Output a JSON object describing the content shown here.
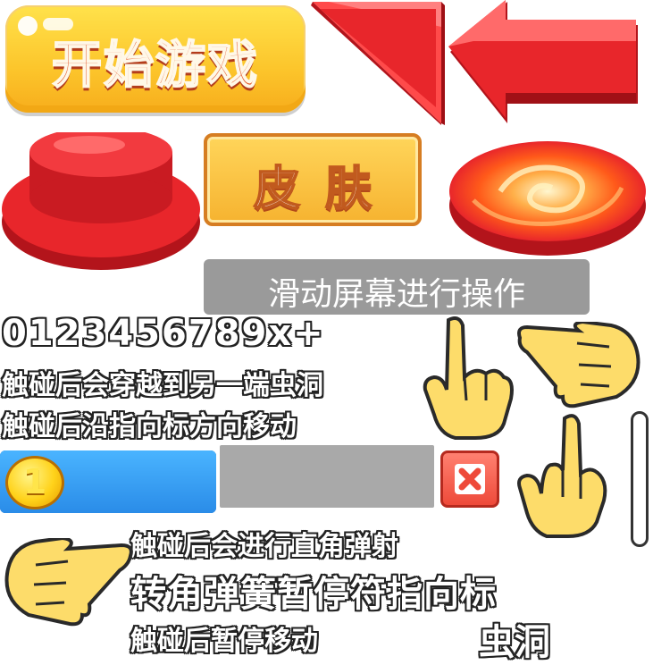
{
  "start_button": {
    "label": "开始游戏"
  },
  "skin_button": {
    "label": "皮肤"
  },
  "slide_banner": {
    "text": "滑动屏幕进行操作"
  },
  "digits": {
    "text": "0123456789x+"
  },
  "hints": {
    "wormhole": "触碰后会穿越到另一端虫洞",
    "arrow_direction": "触碰后沿指向标方向移动",
    "right_angle": "触碰后会进行直角弹射",
    "pause": "触碰后暂停移动"
  },
  "item_names": {
    "row": "转角弹簧暂停符指向标",
    "wormhole": "虫洞"
  },
  "coin_bar": {
    "value": "1",
    "fill_fraction": 1.0
  },
  "icons": {
    "start": "start-button",
    "arrow_wedge": "red-wedge-arrow-icon",
    "arrow_left": "red-arrow-left-icon",
    "red_pad": "red-pressure-pad-icon",
    "wormhole": "wormhole-pad-icon",
    "hand_down": "pointing-hand-down-icon",
    "hand_left": "pointing-hand-left-icon",
    "hand_up": "pointing-hand-up-icon",
    "hand_right": "pointing-hand-right-icon",
    "coin": "coin-icon",
    "close": "close-icon"
  },
  "colors": {
    "red": "#e8262b",
    "yellow": "#fcd84d",
    "blue": "#2a8ce8",
    "gray": "#9a9a9a"
  }
}
